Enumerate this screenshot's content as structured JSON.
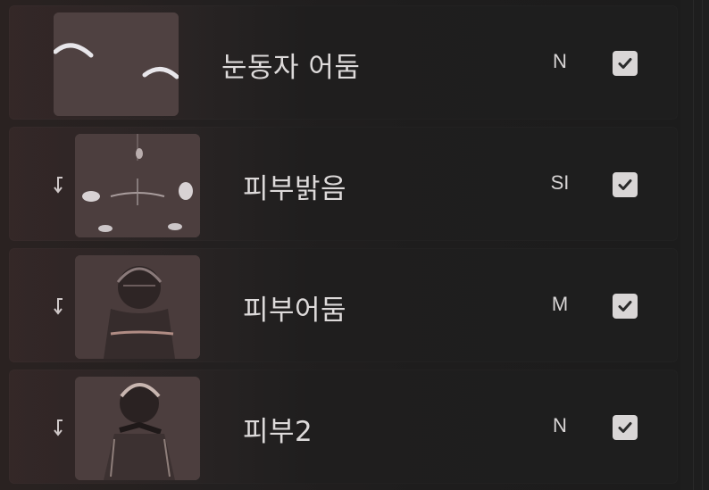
{
  "layers": [
    {
      "name": "눈동자 어둠",
      "blend_mode": "N",
      "visible": true,
      "clipped": false,
      "thumbnail": "eye-shadow-thumbnail"
    },
    {
      "name": "피부밝음",
      "blend_mode": "SI",
      "visible": true,
      "clipped": true,
      "thumbnail": "skin-highlight-thumbnail"
    },
    {
      "name": "피부어둠",
      "blend_mode": "M",
      "visible": true,
      "clipped": true,
      "thumbnail": "skin-shadow-thumbnail"
    },
    {
      "name": "피부2",
      "blend_mode": "N",
      "visible": true,
      "clipped": true,
      "thumbnail": "skin-base-thumbnail"
    }
  ],
  "icons": {
    "clipping": "clipping-mask-arrow-icon",
    "visibility": "checkmark-icon"
  },
  "colors": {
    "panel_background": "#1c1b1b",
    "layer_background": "#1e1e1e",
    "text": "#dddada",
    "checkbox": "#d9d6d6"
  }
}
